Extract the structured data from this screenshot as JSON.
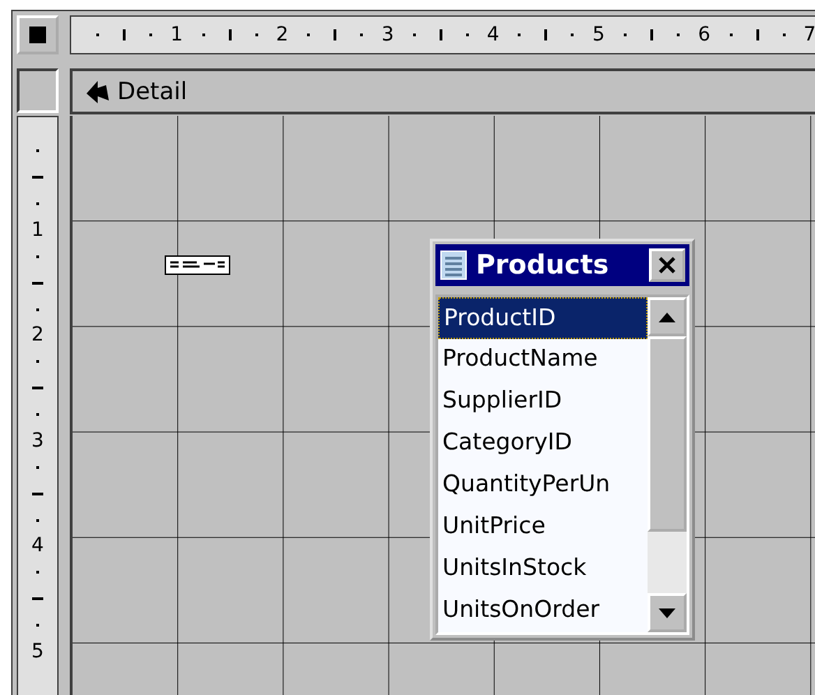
{
  "ruler": {
    "top_numbers": [
      "1",
      "2",
      "3",
      "4",
      "5",
      "6",
      "7"
    ],
    "side_numbers": [
      "1",
      "2",
      "3",
      "4",
      "5"
    ]
  },
  "section": {
    "title": "Detail"
  },
  "field_list": {
    "title": "Products",
    "fields": [
      {
        "name": "ProductID",
        "selected": true
      },
      {
        "name": "ProductName",
        "selected": false
      },
      {
        "name": "SupplierID",
        "selected": false
      },
      {
        "name": "CategoryID",
        "selected": false
      },
      {
        "name": "QuantityPerUn",
        "selected": false
      },
      {
        "name": "UnitPrice",
        "selected": false
      },
      {
        "name": "UnitsInStock",
        "selected": false
      },
      {
        "name": "UnitsOnOrder",
        "selected": false
      }
    ]
  }
}
